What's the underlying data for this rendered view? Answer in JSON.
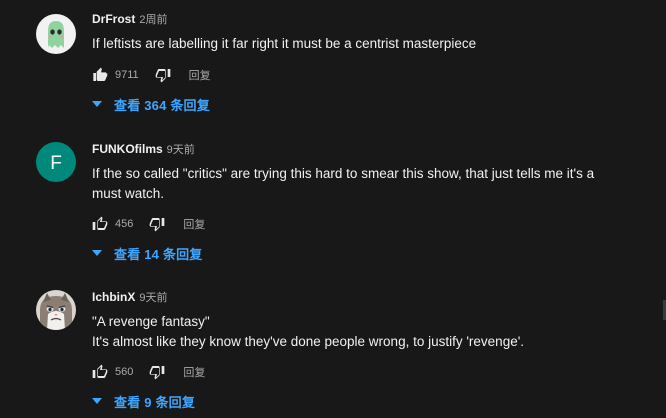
{
  "comments": [
    {
      "author": "DrFrost",
      "time": "2周前",
      "lines": [
        "If leftists are labelling it far right it must be a centrist masterpiece"
      ],
      "likes": "9711",
      "reply_label": "回复",
      "view_replies": "查看 364 条回复",
      "liked": true,
      "avatar": "ghost-avatar"
    },
    {
      "author": "FUNKOfilms",
      "time": "9天前",
      "lines": [
        "If the so called \"critics\" are trying this hard to smear this show, that just tells me it's a",
        "must watch."
      ],
      "likes": "456",
      "reply_label": "回复",
      "view_replies": "查看 14 条回复",
      "liked": false,
      "avatar": "letter-avatar",
      "avatar_letter": "F",
      "avatar_color": "#00897b"
    },
    {
      "author": "IchbinX",
      "time": "9天前",
      "lines": [
        "\"A revenge fantasy\"",
        "It's almost like they know they've done people wrong, to justify 'revenge'."
      ],
      "likes": "560",
      "reply_label": "回复",
      "view_replies": "查看 9 条回复",
      "liked": false,
      "avatar": "cat-avatar"
    }
  ],
  "colors": {
    "background": "#181818",
    "link": "#3ea6ff",
    "secondary_text": "#aaaaaa"
  }
}
